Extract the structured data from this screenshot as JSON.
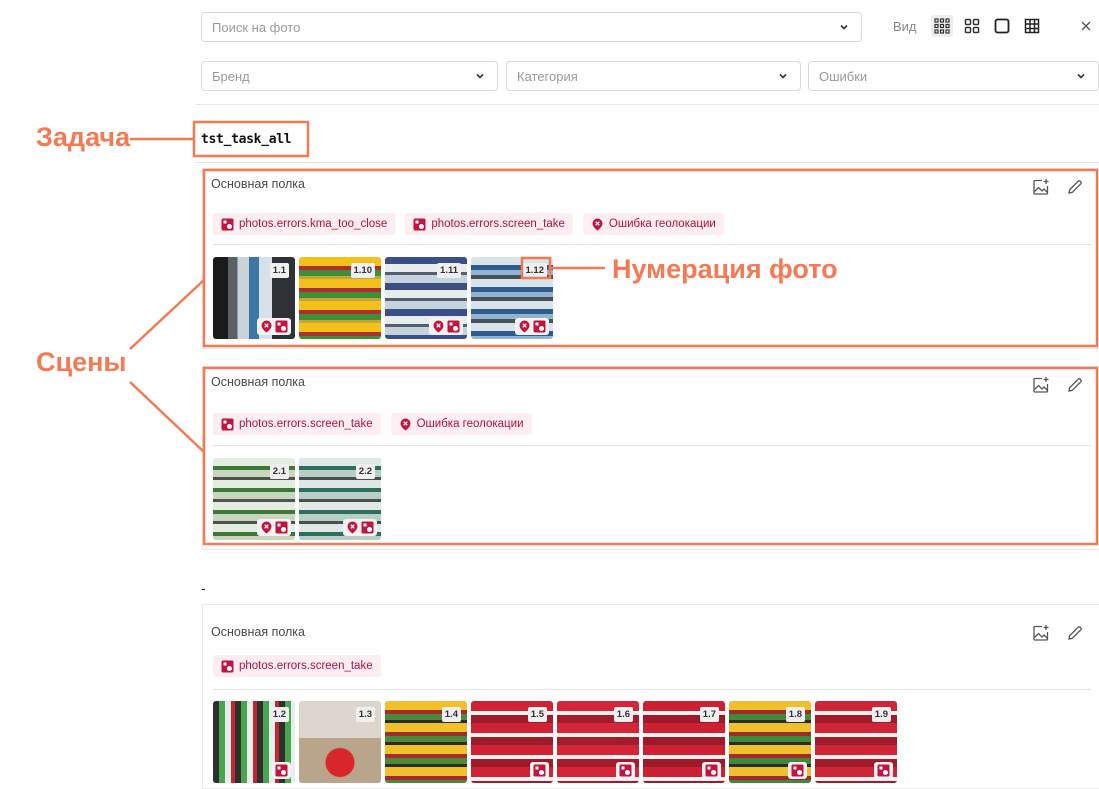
{
  "filters": {
    "search_placeholder": "Поиск на фото",
    "brand_placeholder": "Бренд",
    "category_placeholder": "Категория",
    "errors_placeholder": "Ошибки",
    "view_label": "Вид"
  },
  "view_modes": [
    "grid-small-icon",
    "grid-medium-icon",
    "single-icon",
    "table-icon"
  ],
  "task": {
    "title": "tst_task_all",
    "unassigned_label": "-"
  },
  "tag_labels": {
    "kma": "photos.errors.kma_too_close",
    "screen": "photos.errors.screen_take",
    "geo": "Ошибка геолокации"
  },
  "scenes": [
    {
      "title": "Основная полка",
      "tags": [
        {
          "label": "photos.errors.kma_too_close",
          "icon": "photo-error-icon"
        },
        {
          "label": "photos.errors.screen_take",
          "icon": "photo-error-icon"
        },
        {
          "label": "Ошибка геолокации",
          "icon": "geo-error-icon"
        }
      ],
      "photos": [
        {
          "number": "1.1",
          "geo": true,
          "photo": true
        },
        {
          "number": "1.10",
          "geo": false,
          "photo": false
        },
        {
          "number": "1.11",
          "geo": true,
          "photo": true
        },
        {
          "number": "1.12",
          "geo": true,
          "photo": true
        }
      ]
    },
    {
      "title": "Основная полка",
      "tags": [
        {
          "label": "photos.errors.screen_take",
          "icon": "photo-error-icon"
        },
        {
          "label": "Ошибка геолокации",
          "icon": "geo-error-icon"
        }
      ],
      "photos": [
        {
          "number": "2.1",
          "geo": true,
          "photo": true
        },
        {
          "number": "2.2",
          "geo": true,
          "photo": true,
          "selected": true
        }
      ]
    },
    {
      "title": "Основная полка",
      "tags": [
        {
          "label": "photos.errors.screen_take",
          "icon": "photo-error-icon"
        }
      ],
      "photos": [
        {
          "number": "1.2",
          "geo": false,
          "photo": true
        },
        {
          "number": "1.3",
          "geo": false,
          "photo": true
        },
        {
          "number": "1.4",
          "geo": false,
          "photo": true
        },
        {
          "number": "1.5",
          "geo": false,
          "photo": true
        },
        {
          "number": "1.6",
          "geo": false,
          "photo": true
        },
        {
          "number": "1.7",
          "geo": false,
          "photo": true
        },
        {
          "number": "1.8",
          "geo": false,
          "photo": true
        },
        {
          "number": "1.9",
          "geo": false,
          "photo": true
        }
      ]
    }
  ],
  "annotations": {
    "task": "Задача",
    "scenes": "Сцены",
    "numbering": "Нумерация фото"
  },
  "colors": {
    "annotation": "#f37a52",
    "error_tag_bg": "#fdeef1",
    "error_accent": "#c2143f",
    "selected_border": "#2aa6d9"
  }
}
